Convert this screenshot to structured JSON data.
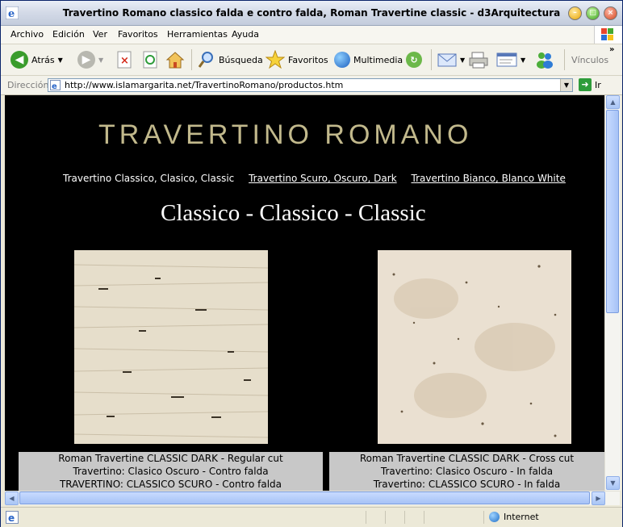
{
  "window": {
    "title": "Travertino Romano classico falda e contro falda, Roman Travertine classic - d3Arquitectura"
  },
  "menu": [
    "Archivo",
    "Edición",
    "Ver",
    "Favoritos",
    "Herramientas",
    "Ayuda"
  ],
  "toolbar": {
    "back": "Atrás",
    "search": "Búsqueda",
    "favorites": "Favoritos",
    "multimedia": "Multimedia",
    "links": "Vínculos"
  },
  "address": {
    "label": "Dirección",
    "url": "http://www.islamargarita.net/TravertinoRomano/productos.htm",
    "go": "Ir"
  },
  "page": {
    "logo": "TRAVERTINO ROMANO",
    "nav": [
      {
        "label": "Travertino Classico, Clasico, Classic",
        "link": false
      },
      {
        "label": "Travertino Scuro, Oscuro, Dark",
        "link": true
      },
      {
        "label": "Travertino Bianco, Blanco White",
        "link": true
      }
    ],
    "heading": "Classico - Classico -  Classic",
    "products": [
      {
        "lines": [
          "Roman Travertine CLASSIC DARK - Regular cut",
          "Travertino: Clasico Oscuro - Contro falda",
          "TRAVERTINO: CLASSICO SCURO - Contro falda"
        ]
      },
      {
        "lines": [
          "Roman Travertine CLASSIC DARK - Cross cut",
          "Travertino: Clasico Oscuro - In falda",
          "Travertino: CLASSICO SCURO - In falda"
        ]
      }
    ]
  },
  "status": {
    "zone": "Internet"
  },
  "colors": {
    "logo": "#c2b98c",
    "page_bg": "#000000",
    "caption_bg": "#c8c8c8"
  }
}
